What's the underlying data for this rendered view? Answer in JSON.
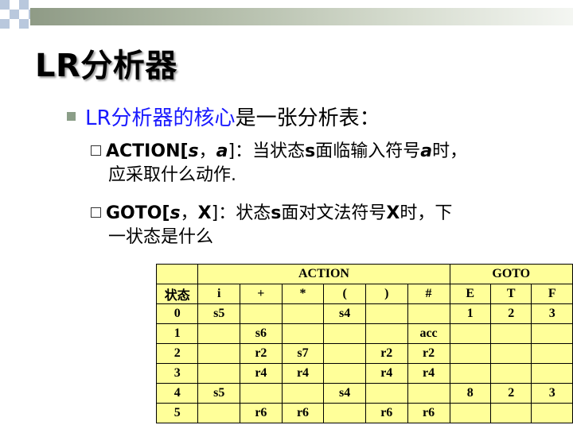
{
  "title": "LR分析器",
  "bullet": {
    "highlight": "LR分析器的核心",
    "rest": "是一张分析表："
  },
  "items": [
    {
      "lead": "ACTION[",
      "arg1": "s",
      "sep": "，",
      "arg2": "a",
      "close": "]：当状态",
      "s": "s",
      "mid": "面临输入符号",
      "a": "a",
      "end": "时，",
      "line2": "应采取什么动作."
    },
    {
      "lead": "GOTO[",
      "arg1": "s",
      "sep": "，",
      "arg2": "X",
      "close": "]：状态",
      "s": "s",
      "mid": "面对文法符号",
      "a": "X",
      "end": "时，下",
      "line2": "一状态是什么"
    }
  ],
  "table": {
    "group_headers": [
      "ACTION",
      "GOTO"
    ],
    "state_label": "状态",
    "columns": [
      "i",
      "+",
      "*",
      "(",
      ")",
      "#",
      "E",
      "T",
      "F"
    ],
    "rows": [
      [
        "0",
        "s5",
        "",
        "",
        "s4",
        "",
        "",
        "1",
        "2",
        "3"
      ],
      [
        "1",
        "",
        "s6",
        "",
        "",
        "",
        "acc",
        "",
        "",
        ""
      ],
      [
        "2",
        "",
        "r2",
        "s7",
        "",
        "r2",
        "r2",
        "",
        "",
        ""
      ],
      [
        "3",
        "",
        "r4",
        "r4",
        "",
        "r4",
        "r4",
        "",
        "",
        ""
      ],
      [
        "4",
        "s5",
        "",
        "",
        "s4",
        "",
        "",
        "8",
        "2",
        "3"
      ],
      [
        "5",
        "",
        "r6",
        "r6",
        "",
        "r6",
        "r6",
        "",
        "",
        ""
      ]
    ]
  }
}
